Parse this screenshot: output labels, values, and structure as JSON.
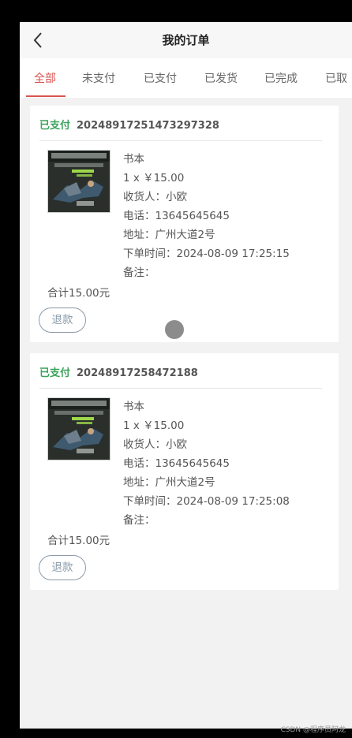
{
  "header": {
    "title": "我的订单",
    "back_icon": "chevron-left-icon"
  },
  "tabs": [
    {
      "label": "全部",
      "active": true
    },
    {
      "label": "未支付",
      "active": false
    },
    {
      "label": "已支付",
      "active": false
    },
    {
      "label": "已发货",
      "active": false
    },
    {
      "label": "已完成",
      "active": false
    },
    {
      "label": "已取",
      "active": false
    }
  ],
  "colors": {
    "accent": "#d9534f",
    "status_paid": "#3aa35a",
    "button_border": "#8a9aa8"
  },
  "orders": [
    {
      "status": "已支付",
      "order_no": "20248917251473297328",
      "product_name": "书本",
      "qty_price": "1 x ￥15.00",
      "receiver": "收货人：小欧",
      "phone": "电话：13645645645",
      "address": "地址：广州大道2号",
      "order_time": "下单时间：2024-08-09 17:25:15",
      "note": "备注：",
      "total": "合计15.00元",
      "refund_label": "退款"
    },
    {
      "status": "已支付",
      "order_no": "20248917258472188",
      "product_name": "书本",
      "qty_price": "1 x ￥15.00",
      "receiver": "收货人：小欧",
      "phone": "电话：13645645645",
      "address": "地址：广州大道2号",
      "order_time": "下单时间：2024-08-09 17:25:08",
      "note": "备注：",
      "total": "合计15.00元",
      "refund_label": "退款"
    }
  ],
  "watermark": "CSDN @程序员阿龙"
}
